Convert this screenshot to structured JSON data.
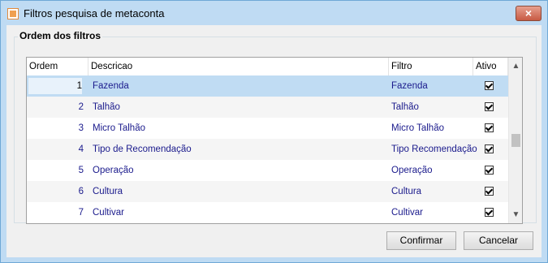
{
  "window": {
    "title": "Filtros pesquisa de metaconta",
    "close_label": "×"
  },
  "group": {
    "title": "Ordem dos filtros"
  },
  "columns": {
    "ordem": "Ordem",
    "descricao": "Descricao",
    "filtro": "Filtro",
    "ativo": "Ativo"
  },
  "rows": [
    {
      "ordem": "1",
      "descricao": "Fazenda",
      "filtro": "Fazenda",
      "ativo": true
    },
    {
      "ordem": "2",
      "descricao": "Talhão",
      "filtro": "Talhão",
      "ativo": true
    },
    {
      "ordem": "3",
      "descricao": "Micro Talhão",
      "filtro": "Micro Talhão",
      "ativo": true
    },
    {
      "ordem": "4",
      "descricao": "Tipo de Recomendação",
      "filtro": "Tipo Recomendação",
      "ativo": true
    },
    {
      "ordem": "5",
      "descricao": "Operação",
      "filtro": "Operação",
      "ativo": true
    },
    {
      "ordem": "6",
      "descricao": "Cultura",
      "filtro": "Cultura",
      "ativo": true
    },
    {
      "ordem": "7",
      "descricao": "Cultivar",
      "filtro": "Cultivar",
      "ativo": true
    }
  ],
  "selected_row": 0,
  "buttons": {
    "confirm": "Confirmar",
    "cancel": "Cancelar"
  }
}
